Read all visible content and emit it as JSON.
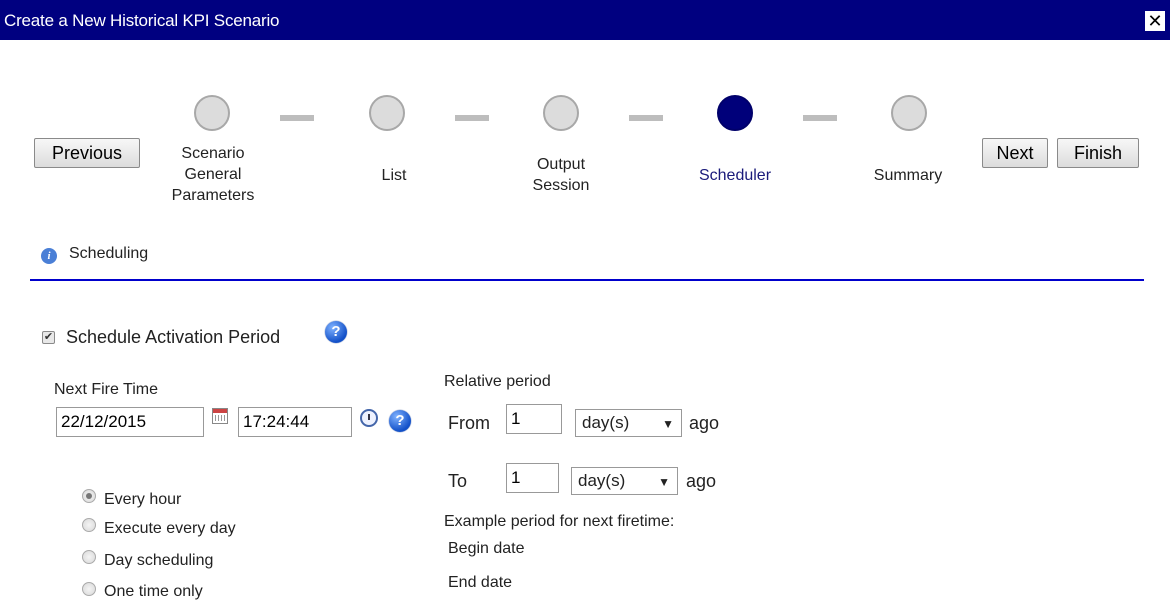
{
  "dialog": {
    "title": "Create a New Historical KPI Scenario"
  },
  "nav": {
    "previous": "Previous",
    "next": "Next",
    "finish": "Finish"
  },
  "steps": [
    {
      "line1": "Scenario",
      "line2": "General",
      "line3": "Parameters"
    },
    {
      "line1": "List"
    },
    {
      "line1": "Output",
      "line2": "Session"
    },
    {
      "line1": "Scheduler",
      "active": true
    },
    {
      "line1": "Summary"
    }
  ],
  "section": {
    "title": "Scheduling"
  },
  "schedule": {
    "activation_label": "Schedule Activation Period",
    "activation_checked": true,
    "next_fire_label": "Next Fire Time",
    "date_value": "22/12/2015",
    "time_value": "17:24:44",
    "options": [
      "Every hour",
      "Execute every day",
      "Day scheduling",
      "One time only"
    ],
    "selected_option": "Every hour"
  },
  "relative": {
    "title": "Relative period",
    "from_label": "From",
    "from_value": "1",
    "from_unit": "day(s)",
    "to_label": "To",
    "to_value": "1",
    "to_unit": "day(s)",
    "ago": "ago",
    "example_label": "Example period for next firetime:",
    "begin_label": "Begin date",
    "end_label": "End date"
  },
  "colors": {
    "titlebar": "#000080",
    "accent_line": "#0000cc",
    "active_step": "#00007a"
  }
}
